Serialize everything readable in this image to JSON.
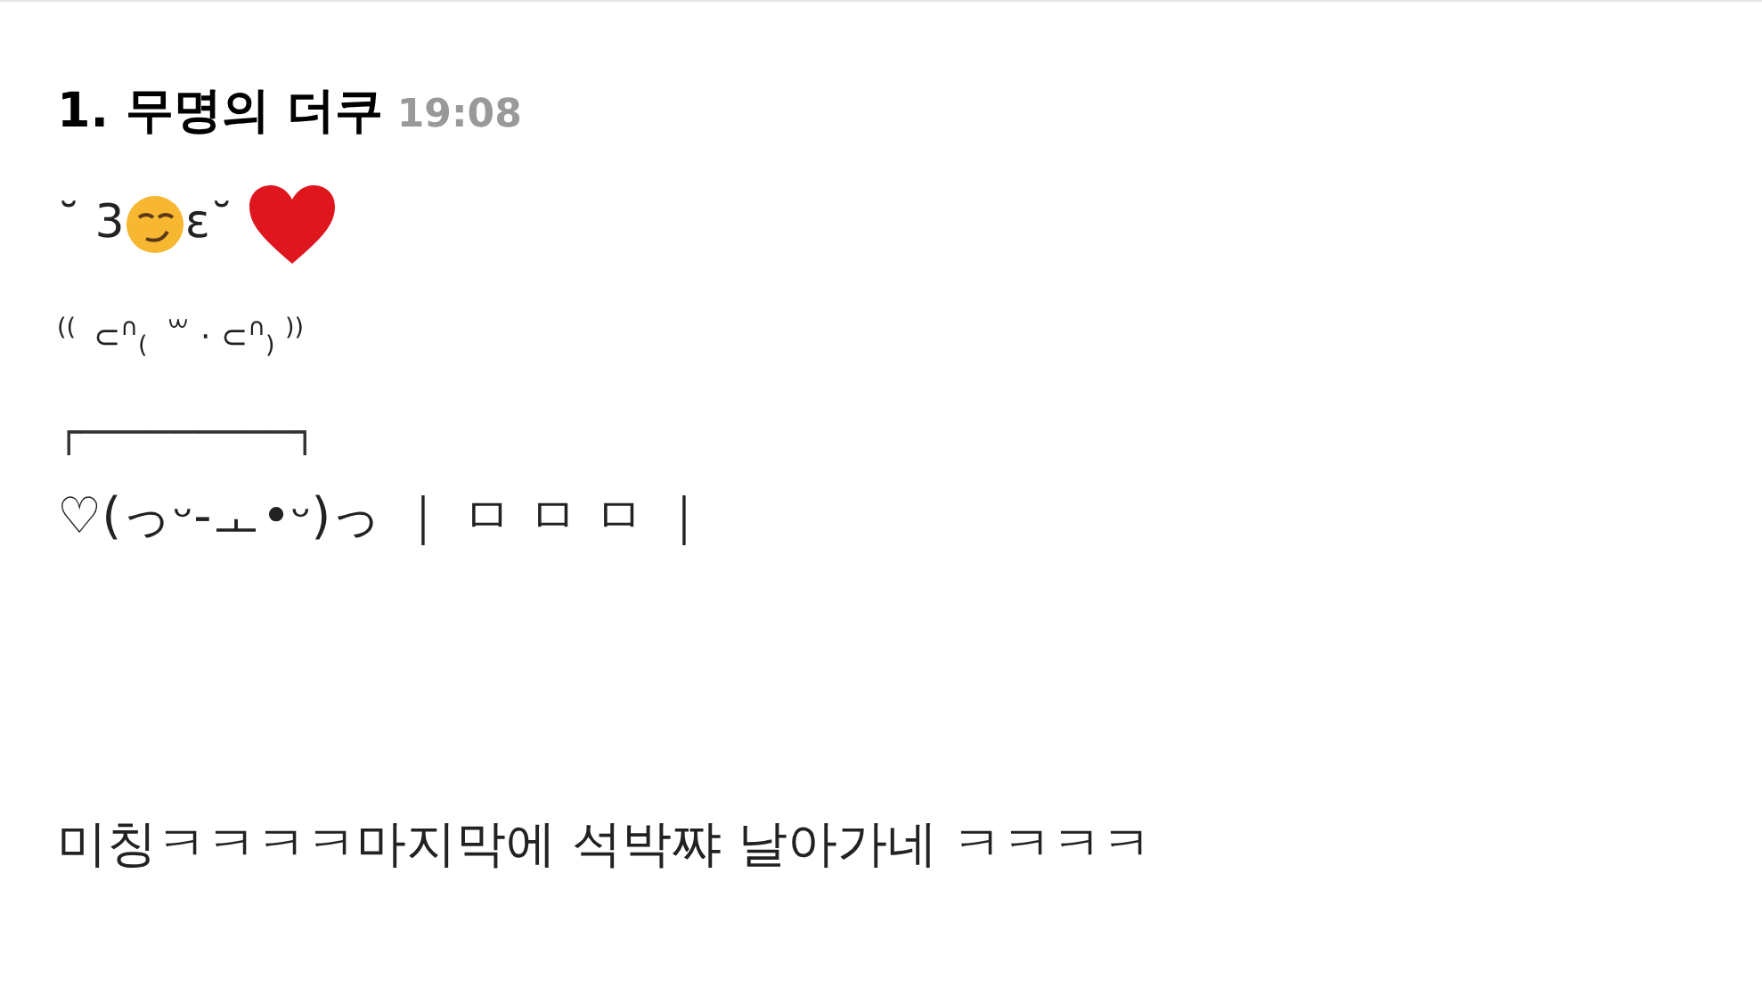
{
  "comment": {
    "number": "1.",
    "author": "무명의 더쿠",
    "time": "19:08",
    "lines": [
      {
        "kind": "parts",
        "parts": [
          {
            "kind": "text",
            "text": "˘ 3"
          },
          {
            "kind": "face"
          },
          {
            "kind": "text",
            "text": "ε˘ "
          },
          {
            "kind": "heart"
          }
        ]
      },
      {
        "kind": "small",
        "text": "$^{(( }$ ⊂$^{∩}$$_{( }$ ꒳ · ⊂$^{∩}$$_{)}$ $^{))}$"
      },
      {
        "kind": "rule",
        "text": "┌─────────┐"
      },
      {
        "kind": "plain",
        "text": "♡(っᵕ-ㅗ•ᵕ)っ ｜ ㅁ ㅁ ㅁ ｜"
      },
      {
        "kind": "gap"
      },
      {
        "kind": "plain",
        "text": "미칭ㅋㅋㅋㅋ마지막에 석박쨔 날아가네 ㅋㅋㅋㅋ"
      }
    ]
  }
}
